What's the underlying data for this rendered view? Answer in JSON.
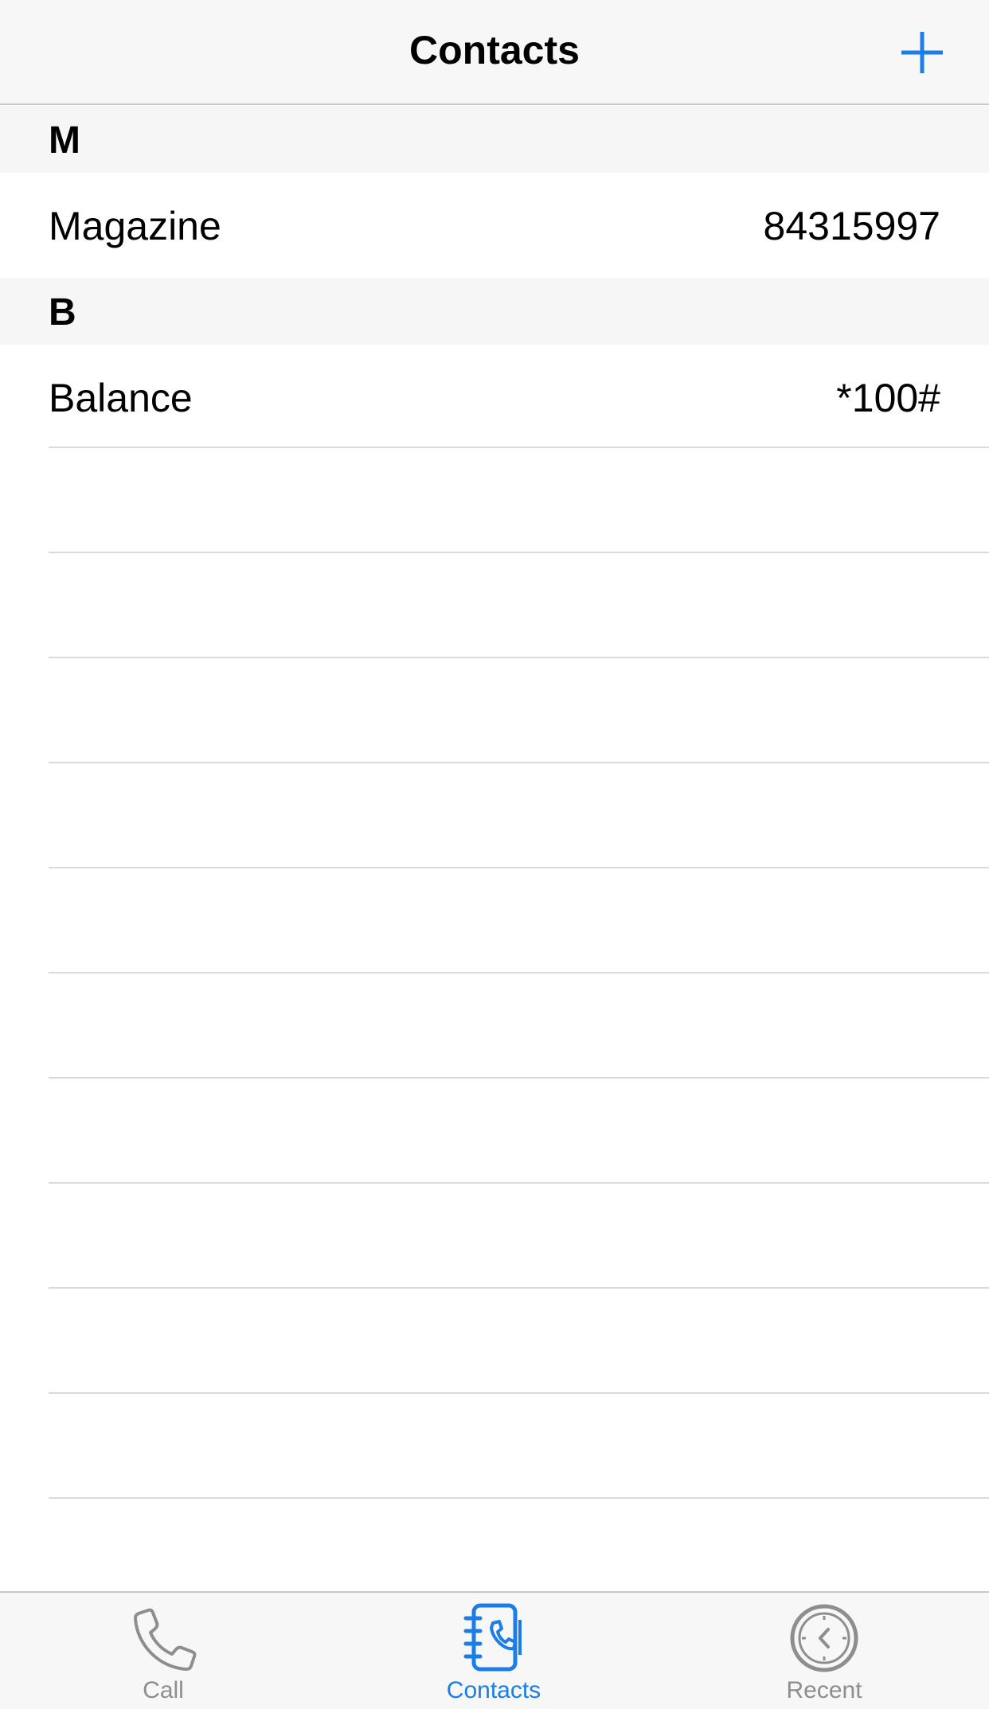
{
  "nav": {
    "title": "Contacts"
  },
  "colors": {
    "accent": "#1a7ee6",
    "inactive": "#8e8e8e"
  },
  "sections": [
    {
      "letter": "M",
      "contacts": [
        {
          "name": "Magazine",
          "number": "84315997"
        }
      ]
    },
    {
      "letter": "B",
      "contacts": [
        {
          "name": "Balance",
          "number": "*100#"
        }
      ]
    }
  ],
  "tabs": [
    {
      "label": "Call",
      "icon": "phone-icon",
      "active": false
    },
    {
      "label": "Contacts",
      "icon": "contacts-book-icon",
      "active": true
    },
    {
      "label": "Recent",
      "icon": "clock-icon",
      "active": false
    }
  ]
}
